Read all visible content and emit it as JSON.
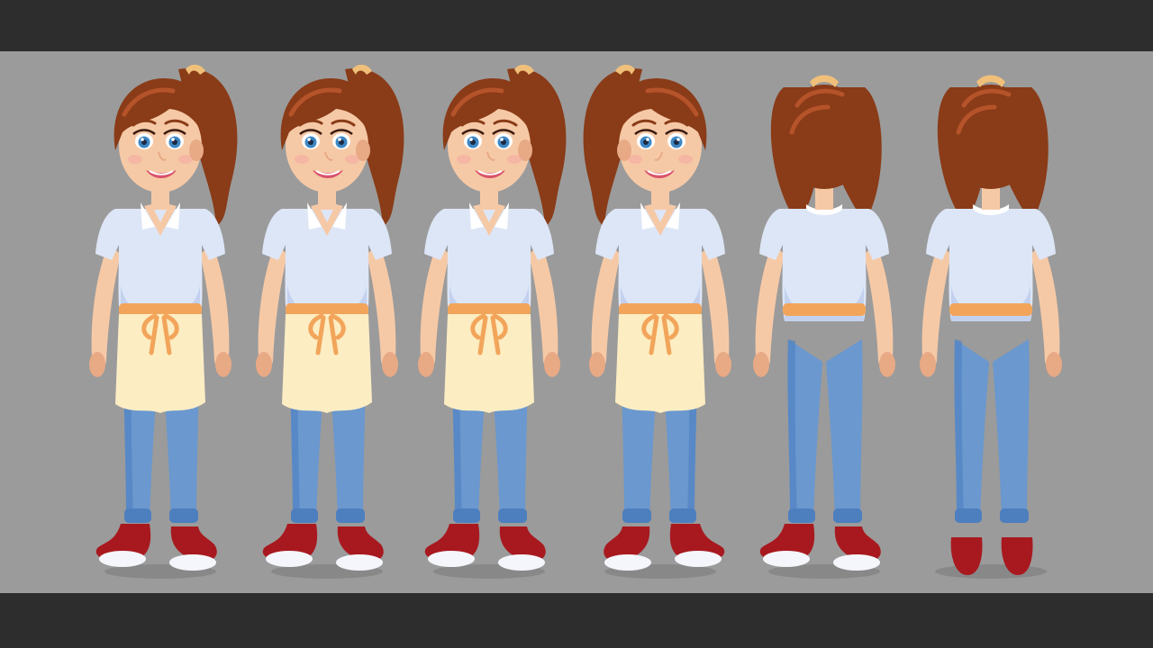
{
  "colors": {
    "letterbox": "#2d2d2d",
    "backdrop": "#9b9b9b",
    "hair": "#8a3b17",
    "hair_highlight": "#b5532a",
    "skin": "#f6c9a6",
    "skin_shadow": "#e8a985",
    "shirt": "#dde6f7",
    "shirt_shadow": "#b8c8ea",
    "apron": "#fdedc3",
    "apron_band": "#f2a55a",
    "jeans": "#6a98cf",
    "jeans_shadow": "#4d7fbf",
    "shoe_red": "#a8191f",
    "shoe_white": "#f4f6fb",
    "eyes": "#3d86c4",
    "lips": "#d9536b",
    "scrunchie": "#f0c07a"
  },
  "turnaround": {
    "poses": [
      {
        "view": "three-quarter-front-left",
        "facing": 1
      },
      {
        "view": "slight-three-quarter-left",
        "facing": 1
      },
      {
        "view": "front",
        "facing": 0
      },
      {
        "view": "three-quarter-front-right",
        "facing": -1
      },
      {
        "view": "three-quarter-back",
        "facing": 2
      },
      {
        "view": "back",
        "facing": 3
      }
    ]
  }
}
